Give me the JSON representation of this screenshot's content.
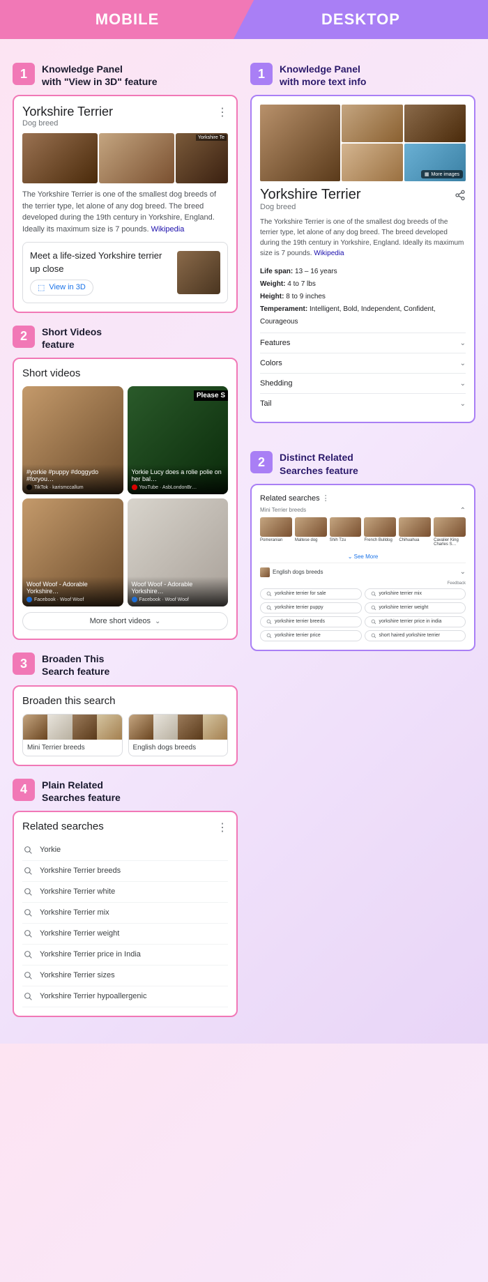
{
  "header": {
    "mobile": "MOBILE",
    "desktop": "DESKTOP"
  },
  "mobile": {
    "s1": {
      "num": "1",
      "title": "Knowledge Panel\nwith \"View in 3D\" feature"
    },
    "kp": {
      "title": "Yorkshire Terrier",
      "sub": "Dog breed",
      "body": "The Yorkshire Terrier is one of the smallest dog breeds of the terrier type, let alone of any dog breed. The breed developed during the 19th century in Yorkshire, England. Ideally its maximum size is 7 pounds. ",
      "wiki": "Wikipedia",
      "v3d_text": "Meet a life-sized Yorkshire terrier up close",
      "v3d_btn": "View in 3D",
      "img3_label": "Yorkshire Te"
    },
    "s2": {
      "num": "2",
      "title": "Short Videos\nfeature"
    },
    "sv": {
      "title": "Short videos",
      "items": [
        {
          "cap": "#yorkie #puppy #doggydo #foryou…",
          "src": "TikTok · karismccallum",
          "color": "#000",
          "overlay": ""
        },
        {
          "cap": "Yorkie Lucy does a rolie polie on her bal…",
          "src": "YouTube · AsbLondonBr…",
          "color": "#ff0000",
          "overlay": "Please S"
        },
        {
          "cap": "Woof Woof - Adorable Yorkshire…",
          "src": "Facebook · Woof Woof",
          "color": "#1877f2",
          "overlay": ""
        },
        {
          "cap": "Woof Woof - Adorable Yorkshire…",
          "src": "Facebook · Woof Woof",
          "color": "#1877f2",
          "overlay": ""
        }
      ],
      "more": "More short videos"
    },
    "s3": {
      "num": "3",
      "title": "Broaden This\nSearch feature"
    },
    "bts": {
      "title": "Broaden this search",
      "items": [
        "Mini Terrier breeds",
        "English dogs breeds"
      ]
    },
    "s4": {
      "num": "4",
      "title": "Plain Related\nSearches feature"
    },
    "rel": {
      "title": "Related searches",
      "items": [
        "Yorkie",
        "Yorkshire Terrier breeds",
        "Yorkshire Terrier white",
        "Yorkshire Terrier mix",
        "Yorkshire Terrier weight",
        "Yorkshire Terrier price in India",
        "Yorkshire Terrier sizes",
        "Yorkshire Terrier hypoallergenic"
      ]
    }
  },
  "desktop": {
    "s1": {
      "num": "1",
      "title": "Knowledge Panel\nwith more text info"
    },
    "kp": {
      "title": "Yorkshire Terrier",
      "sub": "Dog breed",
      "more_images": "More images",
      "body": "The Yorkshire Terrier is one of the smallest dog breeds of the terrier type, let alone of any dog breed. The breed developed during the 19th century in Yorkshire, England. Ideally its maximum size is 7 pounds. ",
      "wiki": "Wikipedia",
      "facts": [
        {
          "k": "Life span:",
          "v": " 13 – 16 years"
        },
        {
          "k": "Weight:",
          "v": " 4 to 7 lbs"
        },
        {
          "k": "Height:",
          "v": " 8 to 9 inches"
        },
        {
          "k": "Temperament:",
          "v": " Intelligent, Bold, Independent, Confident, Courageous"
        }
      ],
      "exp": [
        "Features",
        "Colors",
        "Shedding",
        "Tail"
      ]
    },
    "s2": {
      "num": "2",
      "title": "Distinct Related\nSearches feature"
    },
    "rs": {
      "title": "Related searches",
      "sub": "Mini Terrier breeds",
      "thumbs": [
        "Pomeranian",
        "Maltese dog",
        "Shih Tzu",
        "French Bulldog",
        "Chihuahua",
        "Cavalier King Charles S…"
      ],
      "more": "See More",
      "eng": "English dogs breeds",
      "feedback": "Feedback",
      "pills": [
        "yorkshire terrier for sale",
        "yorkshire terrier mix",
        "yorkshire terrier puppy",
        "yorkshire terrier weight",
        "yorkshire terrier breeds",
        "yorkshire terrier price in india",
        "yorkshire terrier price",
        "short haired yorkshire terrier"
      ]
    }
  }
}
